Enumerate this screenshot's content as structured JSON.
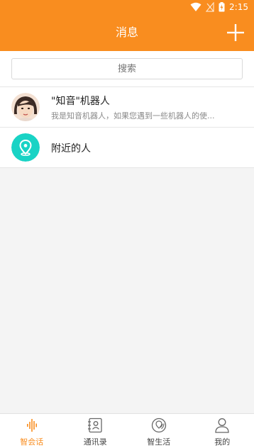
{
  "status_bar": {
    "time": "2:15"
  },
  "app_bar": {
    "title": "消息",
    "add_icon": "plus-icon"
  },
  "search": {
    "placeholder": "搜索"
  },
  "conversations": [
    {
      "name": "\"知音\"机器人",
      "preview": "我是知音机器人，如果您遇到一些机器人的使...",
      "avatar": "robot-avatar"
    },
    {
      "name": "附近的人",
      "avatar": "location-pin-icon"
    }
  ],
  "tabs": [
    {
      "label": "智会话",
      "icon": "soundwave-icon",
      "active": true
    },
    {
      "label": "通讯录",
      "icon": "contacts-book-icon",
      "active": false
    },
    {
      "label": "智生活",
      "icon": "life-circle-icon",
      "active": false
    },
    {
      "label": "我的",
      "icon": "person-icon",
      "active": false
    }
  ],
  "colors": {
    "accent": "#f98d1f",
    "teal": "#19d3c5"
  }
}
